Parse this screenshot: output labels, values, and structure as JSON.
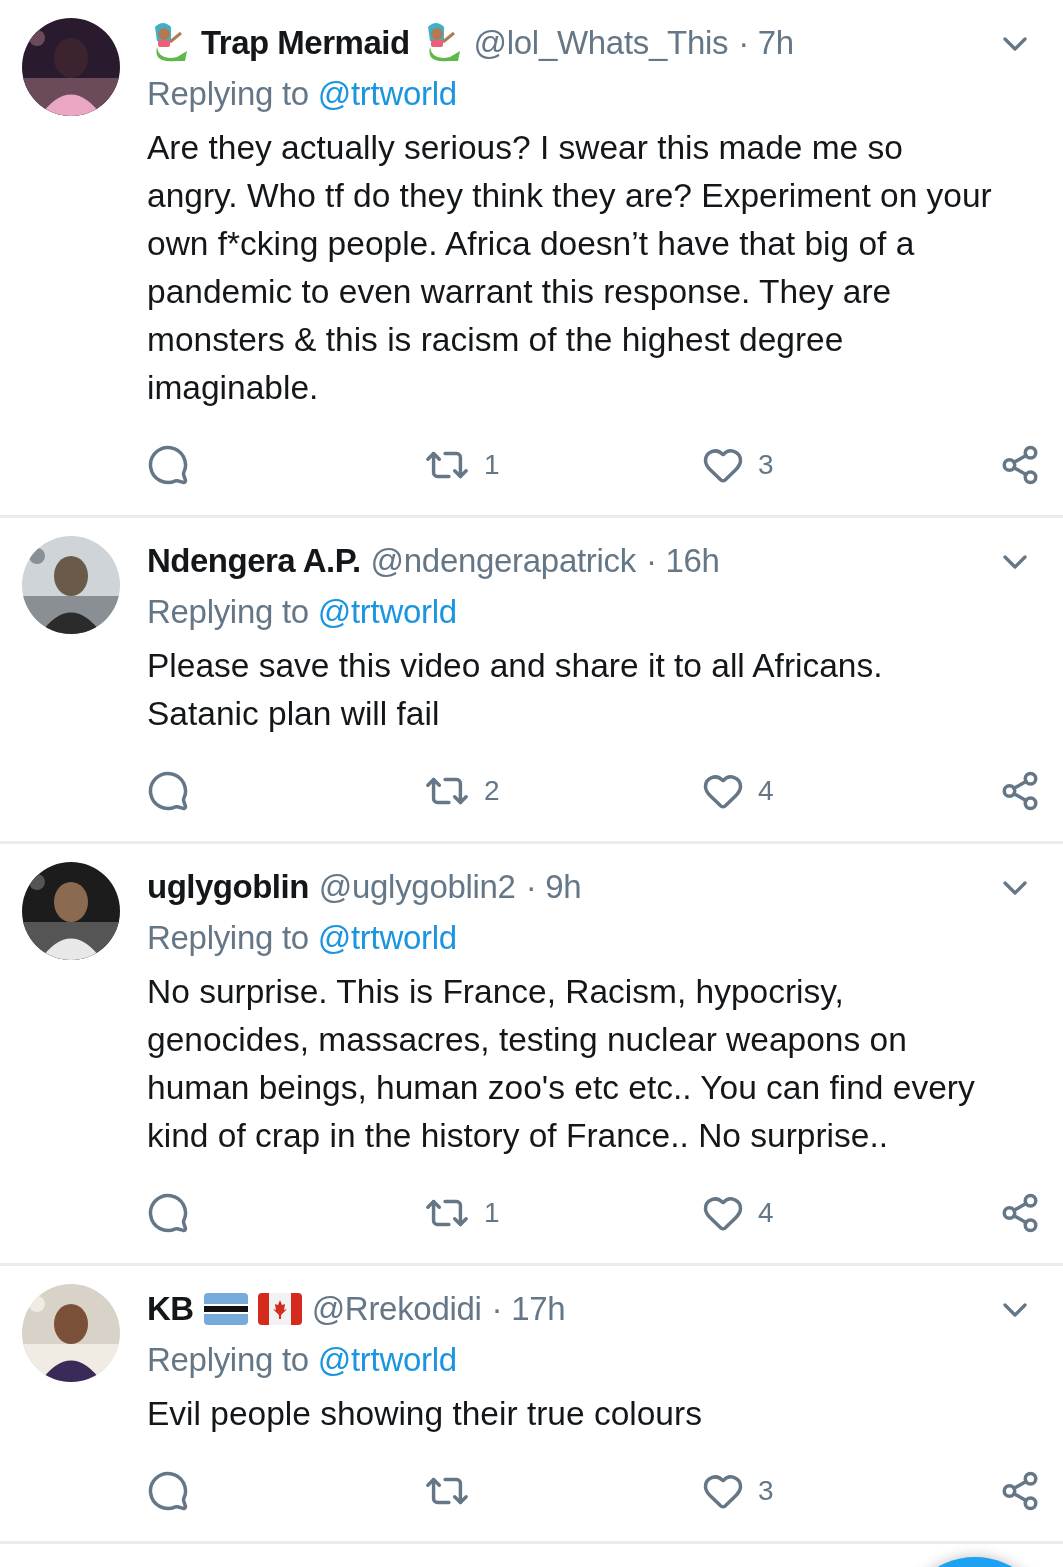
{
  "tweets": [
    {
      "avatar": {
        "kind": "picture"
      },
      "name": "Trap Mermaid",
      "lead_badge": {
        "kind": "mermaid"
      },
      "badges": [
        {
          "kind": "mermaid"
        }
      ],
      "handle": "@lol_Whats_This",
      "time": "· 7h",
      "replying_label": "Replying to",
      "replying_to": "@trtworld",
      "text": "Are they actually serious? I swear this made me so angry. Who tf do they think they are? Experiment on your own f*cking people. Africa doesn’t have that big of a pandemic to even warrant this response. They are monsters & this is racism of the highest degree imaginable.",
      "retweets": "1",
      "likes": "3"
    },
    {
      "avatar": {
        "kind": "picture"
      },
      "name": "Ndengera A.P.",
      "handle": "@ndengerapatrick",
      "time": "· 16h",
      "replying_label": "Replying to",
      "replying_to": "@trtworld",
      "text": "Please save this video and share it to all Africans. Satanic plan will fail",
      "retweets": "2",
      "likes": "4"
    },
    {
      "avatar": {
        "kind": "picture"
      },
      "name": "uglygoblin",
      "handle": "@uglygoblin2",
      "time": "· 9h",
      "replying_label": "Replying to",
      "replying_to": "@trtworld",
      "text": "No surprise. This is France, Racism, hypocrisy, genocides, massacres, testing nuclear weapons on human beings, human zoo's etc etc.. You can find every kind of crap in the history of France.. No surprise..",
      "retweets": "1",
      "likes": "4"
    },
    {
      "avatar": {
        "kind": "picture"
      },
      "name": "KB",
      "badges": [
        {
          "kind": "striped-flag"
        },
        {
          "kind": "leaf-flag"
        }
      ],
      "handle": "@Rrekodidi",
      "time": "· 17h",
      "replying_label": "Replying to",
      "replying_to": "@trtworld",
      "text": "Evil people showing their true colours",
      "likes": "3"
    }
  ],
  "fab": {
    "kind": "floating"
  }
}
